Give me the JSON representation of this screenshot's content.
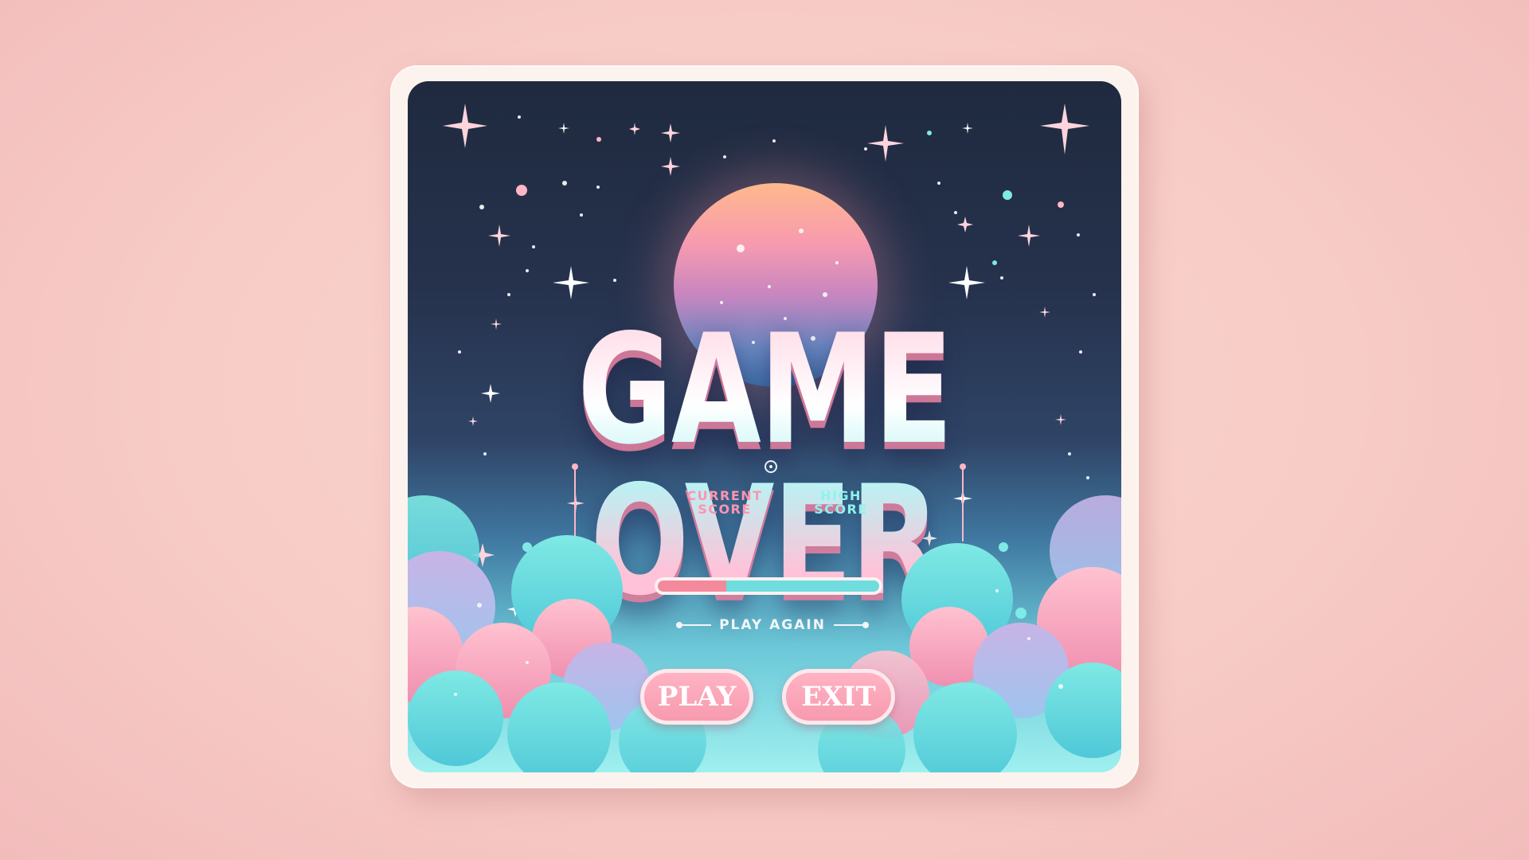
{
  "game_over": {
    "title": "GAME OVER",
    "score_labels": {
      "current": "CURRENT\nSCORE",
      "high": "HIGH\nSCORE"
    },
    "progress_fraction": 0.31,
    "play_again_label": "PLAY AGAIN",
    "buttons": {
      "play_label": "PLAY",
      "exit_label": "EXIT"
    }
  },
  "colors": {
    "background": "#f7cbc6",
    "screen_top": "#1f2a3f",
    "screen_bottom": "#9ff0ef",
    "accent_pink": "#f79ab0",
    "accent_cyan": "#6fdcde"
  },
  "icons": {
    "center": "circle-dot-icon",
    "sparkle": "sparkle-star-icon"
  }
}
